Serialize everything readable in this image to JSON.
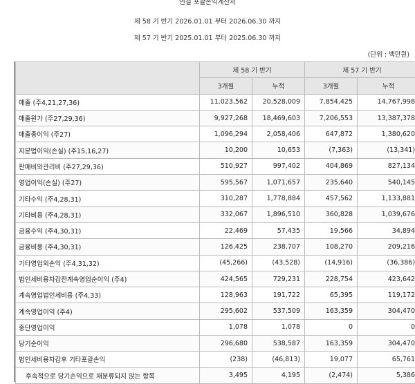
{
  "header": {
    "title": "연결 포괄손익계산서",
    "period_current": "제 58 기 반기 2026.01.01 부터 2026.06.30 까지",
    "period_prior": "제 57 기 반기 2025.01.01 부터 2025.06.30 까지",
    "unit": "(단위 : 백만원)"
  },
  "columns": {
    "group_current": "제 58 기 반기",
    "group_prior": "제 57 기 반기",
    "sub": [
      "3개월",
      "누적",
      "3개월",
      "누적"
    ]
  },
  "rows": [
    {
      "label": "매출 (주4,21,27,36)",
      "values": [
        "11,023,562",
        "20,528,009",
        "7,854,425",
        "14,767,998"
      ]
    },
    {
      "label": "매출원가 (주27,29,36)",
      "values": [
        "9,927,268",
        "18,469,603",
        "7,206,553",
        "13,387,378"
      ]
    },
    {
      "label": "매출총이익 (주27)",
      "values": [
        "1,096,294",
        "2,058,406",
        "647,872",
        "1,380,620"
      ]
    },
    {
      "label": "지분법이익(손실) (주15,16,27)",
      "values": [
        "10,200",
        "10,653",
        "(7,363)",
        "(13,341)"
      ]
    },
    {
      "label": "판매비와관리비 (주27,29,36)",
      "values": [
        "510,927",
        "997,402",
        "404,869",
        "827,134"
      ]
    },
    {
      "label": "영업이익(손실) (주27)",
      "values": [
        "595,567",
        "1,071,657",
        "235,640",
        "540,145"
      ]
    },
    {
      "label": "기타수익 (주4,28,31)",
      "values": [
        "310,287",
        "1,778,884",
        "457,562",
        "1,133,881"
      ]
    },
    {
      "label": "기타비용 (주4,28,31)",
      "values": [
        "332,067",
        "1,896,510",
        "360,828",
        "1,039,676"
      ]
    },
    {
      "label": "금융수익 (주4,30,31)",
      "values": [
        "22,469",
        "57,435",
        "19,566",
        "34,894"
      ]
    },
    {
      "label": "금융비용 (주4,30,31)",
      "values": [
        "126,425",
        "238,707",
        "108,270",
        "209,216"
      ]
    },
    {
      "label": "기타영업외손익 (주4,31,32)",
      "values": [
        "(45,266)",
        "(43,528)",
        "(14,916)",
        "(36,386)"
      ]
    },
    {
      "label": "법인세비용차감전계속영업순이익 (주4)",
      "values": [
        "424,565",
        "729,231",
        "228,754",
        "423,642"
      ]
    },
    {
      "label": "계속영업법인세비용 (주4,33)",
      "values": [
        "128,963",
        "191,722",
        "65,395",
        "119,172"
      ]
    },
    {
      "label": "계속영업이익 (주4)",
      "values": [
        "295,602",
        "537,509",
        "163,359",
        "304,470"
      ]
    },
    {
      "label": "중단영업이익",
      "values": [
        "1,078",
        "1,078",
        "0",
        "0"
      ]
    },
    {
      "label": "당기순이익",
      "values": [
        "296,680",
        "538,587",
        "163,359",
        "304,470"
      ]
    },
    {
      "label": "법인세비용차감후 기타포괄손익",
      "values": [
        "(238)",
        "(46,813)",
        "19,077",
        "65,761"
      ]
    },
    {
      "label": "후속적으로 당기손익으로 재분류되지 않는 항목",
      "values": [
        "3,495",
        "4,195",
        "(2,474)",
        "5,386"
      ],
      "indent": true
    }
  ]
}
